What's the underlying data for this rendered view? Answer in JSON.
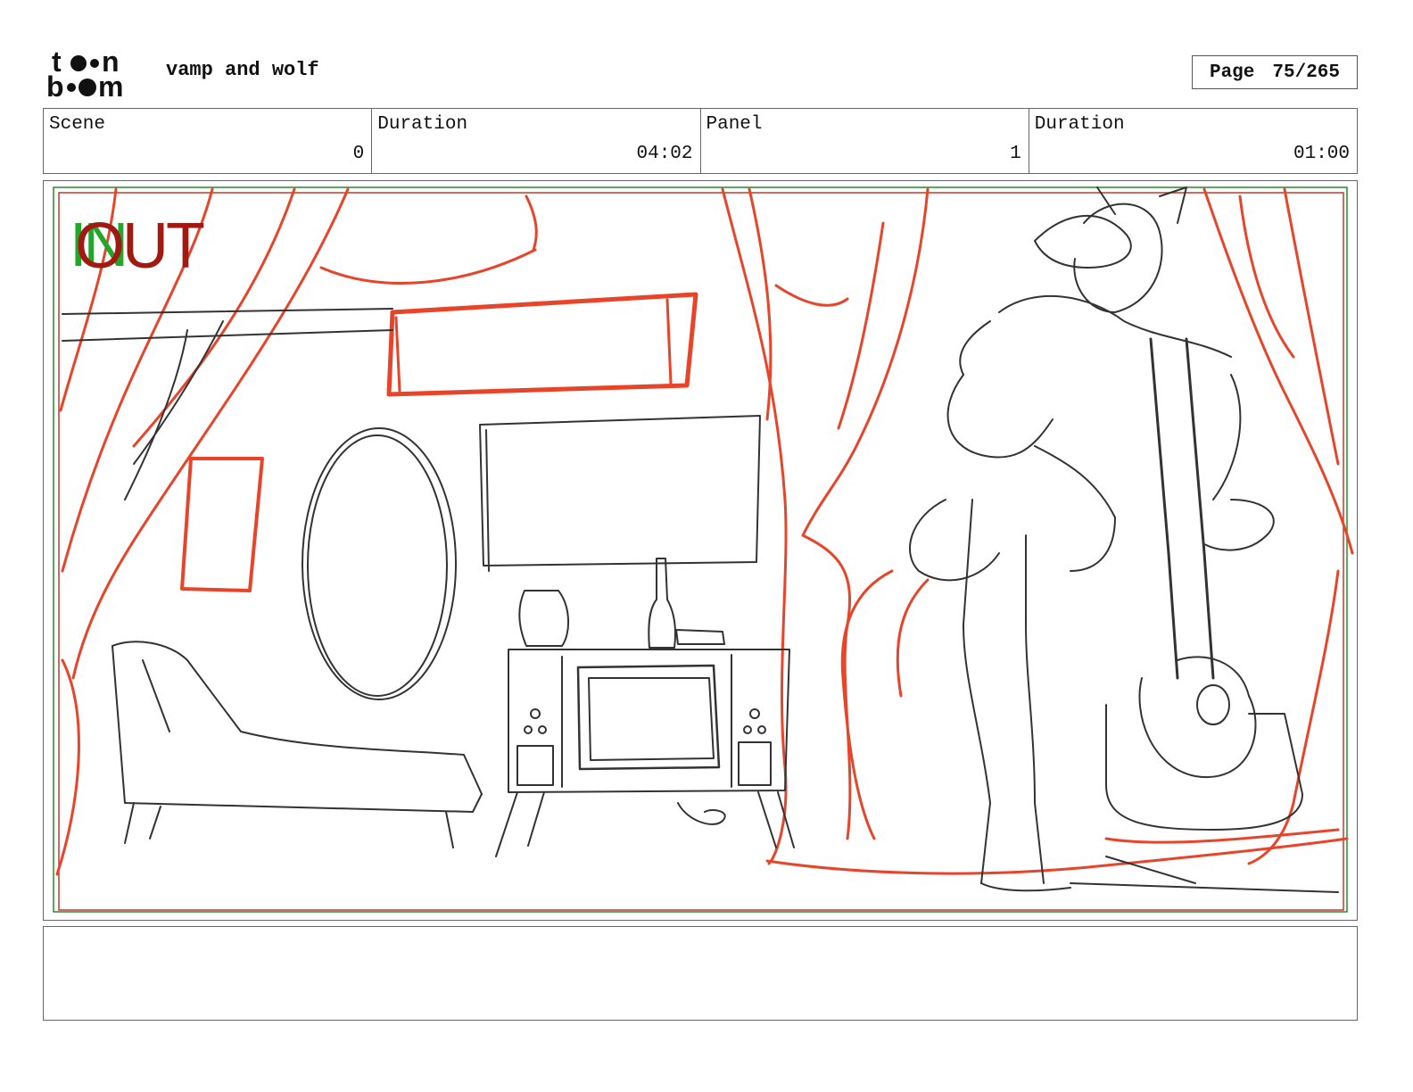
{
  "header": {
    "project_title": "vamp and wolf",
    "page_label": "Page",
    "page_number": "75/265"
  },
  "info": {
    "scene_label": "Scene",
    "scene_value": "0",
    "scene_duration_label": "Duration",
    "scene_duration_value": "04:02",
    "panel_label": "Panel",
    "panel_value": "1",
    "panel_duration_label": "Duration",
    "panel_duration_value": "01:00"
  },
  "panel": {
    "in_marker": "IN",
    "out_marker": "OUT"
  },
  "colors": {
    "sketch_red": "#e8442a",
    "sketch_grey": "#333333",
    "in_green": "#22a829",
    "out_red": "#a01a12"
  },
  "notes": {
    "text": ""
  }
}
